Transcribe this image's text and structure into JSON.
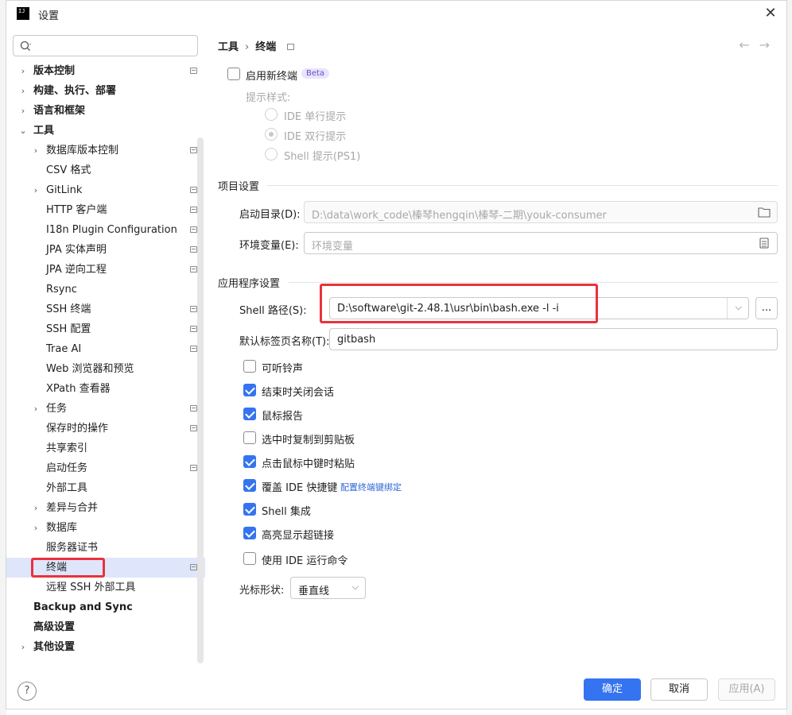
{
  "window": {
    "title": "设置"
  },
  "search": {
    "placeholder": ""
  },
  "sidebar": {
    "items": [
      {
        "label": "版本控制",
        "bold": true,
        "expandable": true,
        "level": 0,
        "pin": true
      },
      {
        "label": "构建、执行、部署",
        "bold": true,
        "expandable": true,
        "level": 0,
        "pin": false
      },
      {
        "label": "语言和框架",
        "bold": true,
        "expandable": true,
        "level": 0,
        "pin": false
      },
      {
        "label": "工具",
        "bold": true,
        "expandable": true,
        "expanded": true,
        "level": 0,
        "pin": false
      },
      {
        "label": "数据库版本控制",
        "expandable": true,
        "level": 1,
        "pin": true
      },
      {
        "label": "CSV 格式",
        "level": 1,
        "pin": false
      },
      {
        "label": "GitLink",
        "expandable": true,
        "level": 1,
        "pin": true
      },
      {
        "label": "HTTP 客户端",
        "level": 1,
        "pin": true
      },
      {
        "label": "I18n Plugin Configuration",
        "level": 1,
        "pin": true
      },
      {
        "label": "JPA 实体声明",
        "level": 1,
        "pin": true
      },
      {
        "label": "JPA 逆向工程",
        "level": 1,
        "pin": true
      },
      {
        "label": "Rsync",
        "level": 1,
        "pin": false
      },
      {
        "label": "SSH 终端",
        "level": 1,
        "pin": true
      },
      {
        "label": "SSH 配置",
        "level": 1,
        "pin": true
      },
      {
        "label": "Trae AI",
        "level": 1,
        "pin": true
      },
      {
        "label": "Web 浏览器和预览",
        "level": 1,
        "pin": false
      },
      {
        "label": "XPath 查看器",
        "level": 1,
        "pin": false
      },
      {
        "label": "任务",
        "expandable": true,
        "level": 1,
        "pin": true
      },
      {
        "label": "保存时的操作",
        "level": 1,
        "pin": true
      },
      {
        "label": "共享索引",
        "level": 1,
        "pin": false
      },
      {
        "label": "启动任务",
        "level": 1,
        "pin": true
      },
      {
        "label": "外部工具",
        "level": 1,
        "pin": false
      },
      {
        "label": "差异与合并",
        "expandable": true,
        "level": 1,
        "pin": false
      },
      {
        "label": "数据库",
        "expandable": true,
        "level": 1,
        "pin": false
      },
      {
        "label": "服务器证书",
        "level": 1,
        "pin": false
      },
      {
        "label": "终端",
        "level": 1,
        "pin": true,
        "selected": true
      },
      {
        "label": "远程 SSH 外部工具",
        "level": 1,
        "pin": false
      },
      {
        "label": "Backup and Sync",
        "bold": true,
        "level": 0,
        "pin": false
      },
      {
        "label": "高级设置",
        "bold": true,
        "level": 0,
        "pin": false
      },
      {
        "label": "其他设置",
        "bold": true,
        "expandable": true,
        "level": 0,
        "pin": false
      }
    ]
  },
  "breadcrumb": {
    "parent": "工具",
    "separator": "›",
    "current": "终端"
  },
  "new_terminal": {
    "label": "启用新终端",
    "badge": "Beta",
    "prompt_style_label": "提示样式:",
    "options": [
      "IDE 单行提示",
      "IDE 双行提示",
      "Shell 提示(PS1)"
    ]
  },
  "project_settings": {
    "title": "项目设置",
    "start_dir_label": "启动目录(D):",
    "start_dir_value": "D:\\data\\work_code\\榛琴hengqin\\榛琴-二期\\youk-consumer",
    "env_label": "环境变量(E):",
    "env_placeholder": "环境变量"
  },
  "app_settings": {
    "title": "应用程序设置",
    "shell_path_label": "Shell 路径(S):",
    "shell_path_value": "D:\\software\\git-2.48.1\\usr\\bin\\bash.exe  -l -i",
    "browse_label": "...",
    "tab_name_label": "默认标签页名称(T):",
    "tab_name_value": "gitbash",
    "checkboxes": [
      {
        "label": "可听铃声",
        "checked": false
      },
      {
        "label": "结束时关闭会话",
        "checked": true
      },
      {
        "label": "鼠标报告",
        "checked": true
      },
      {
        "label": "选中时复制到剪贴板",
        "checked": false
      },
      {
        "label": "点击鼠标中键时粘贴",
        "checked": true
      },
      {
        "label": "覆盖 IDE 快捷键",
        "checked": true,
        "link": "配置终端键绑定"
      },
      {
        "label": "Shell 集成",
        "checked": true
      },
      {
        "label": "高亮显示超链接",
        "checked": true
      },
      {
        "label": "使用 IDE 运行命令",
        "checked": false
      }
    ],
    "cursor_label": "光标形状:",
    "cursor_value": "垂直线"
  },
  "footer": {
    "help": "?",
    "ok": "确定",
    "cancel": "取消",
    "apply": "应用(A)"
  },
  "colors": {
    "accent": "#3574f0",
    "highlight": "#e8323c",
    "selected_row": "#dfe6fb"
  }
}
